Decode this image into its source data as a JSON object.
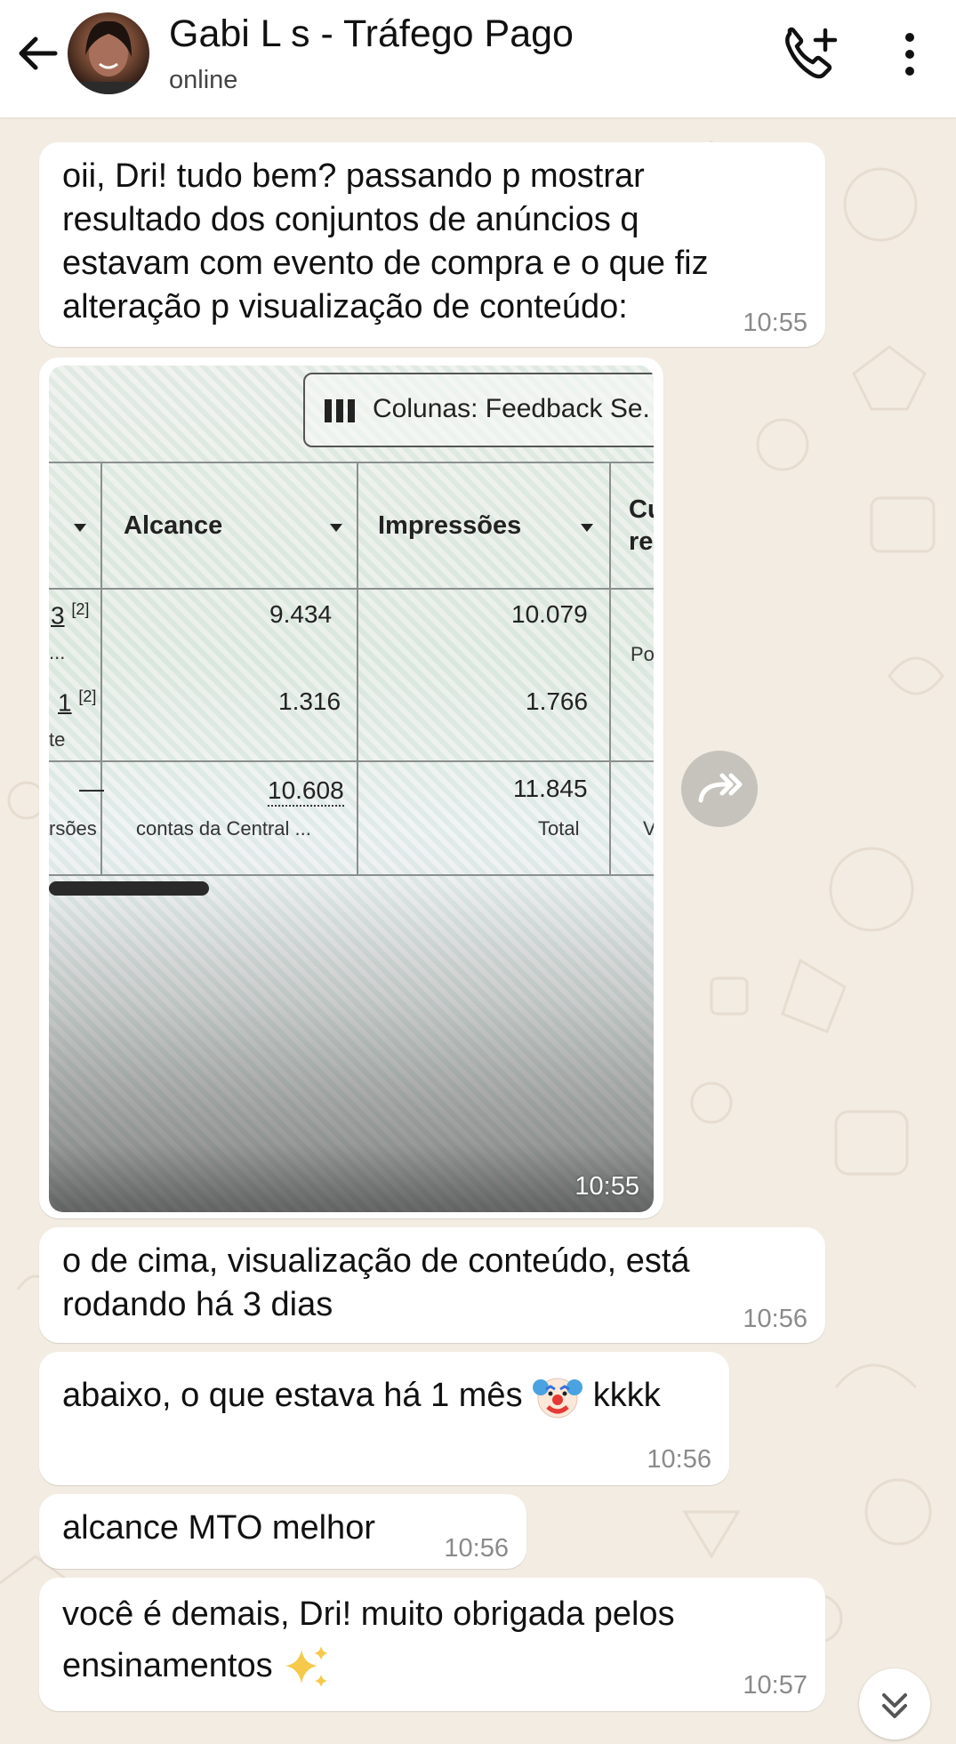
{
  "header": {
    "contact_name": "Gabi L   s - Tráfego Pago",
    "status": "online",
    "back_icon": "arrow-left-icon",
    "call_icon": "add-call-icon",
    "menu_icon": "more-vertical-icon"
  },
  "messages": [
    {
      "text": "oii, Dri! tudo bem? passando p mostrar resultado dos conjuntos de anúncios q estavam com evento de compra e o que fiz alteração p visualização de conteúdo:",
      "time": "10:55"
    },
    {
      "type": "image",
      "time": "10:55"
    },
    {
      "text": "o de cima, visualização de conteúdo, está rodando há 3 dias",
      "time": "10:56"
    },
    {
      "text": "abaixo, o que estava há 1 mês",
      "emoji": "clown-face",
      "text_after": "kkkk",
      "time": "10:56"
    },
    {
      "text": "alcance MTO melhor",
      "time": "10:56"
    },
    {
      "text": "você é demais, Dri! muito obrigada pelos ensinamentos",
      "emoji": "sparkles",
      "time": "10:57"
    }
  ],
  "photo": {
    "columns_button": "Colunas: Feedback Se.",
    "headers": [
      "Alcance",
      "Impressões",
      "Cu",
      "re"
    ],
    "row1": {
      "left": "3",
      "sup": "[2]",
      "alcance": "9.434",
      "impressoes": "10.079",
      "extra": "Po",
      "left_sub": "..."
    },
    "row2": {
      "left": "1",
      "sup": "[2]",
      "alcance": "1.316",
      "impressoes": "1.766",
      "left_sub": "te"
    },
    "total": {
      "dash": "—",
      "alcance": "10.608",
      "impressoes": "11.845",
      "left_label": "rsões",
      "alcance_label": "contas da Central ...",
      "impressoes_label": "Total",
      "extra": "V"
    }
  },
  "colors": {
    "background": "#f3ece2",
    "bubble": "#ffffff",
    "time": "#8a8a8a"
  }
}
